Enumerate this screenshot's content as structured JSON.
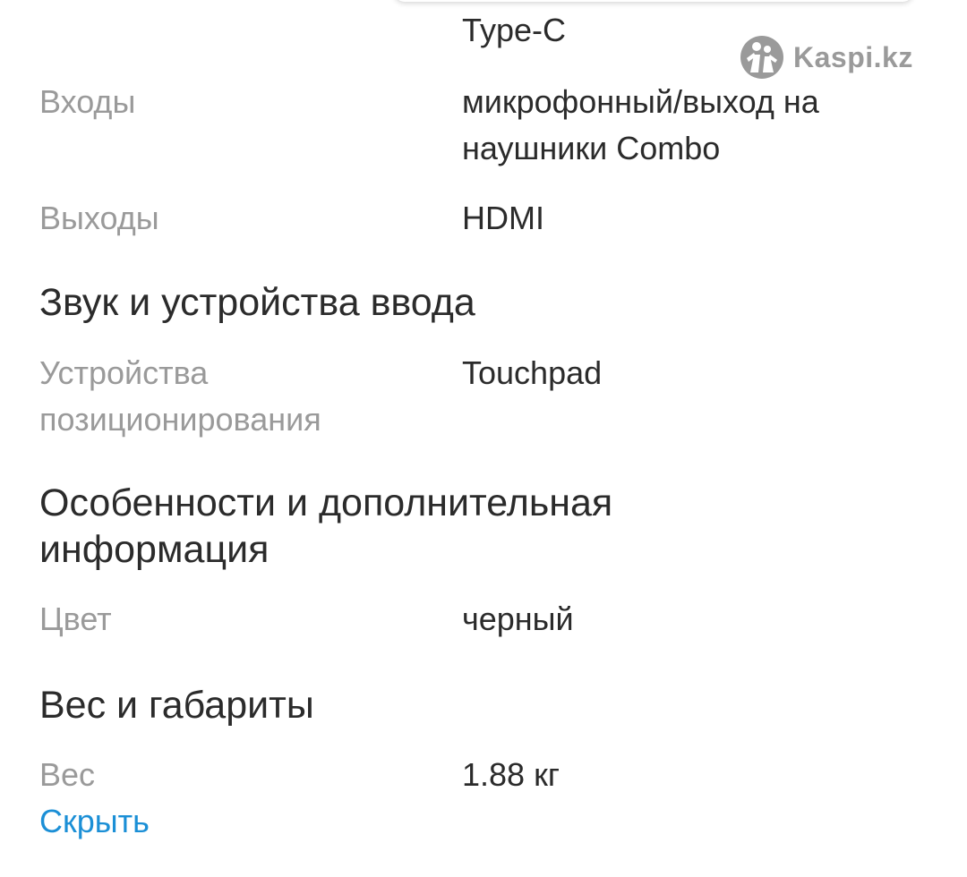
{
  "watermark": {
    "brand": "Kaspi.kz",
    "color": "#9a9a9a"
  },
  "top_partial": {
    "value_line2": "Type-C"
  },
  "specs": {
    "inputs": {
      "label": "Входы",
      "value_line1": "микрофонный/выход на",
      "value_line2": "наушники Combo"
    },
    "outputs": {
      "label": "Выходы",
      "value": "HDMI"
    },
    "sound_section_title": "Звук и устройства ввода",
    "pointing_devices": {
      "label_line1": "Устройства",
      "label_line2": "позиционирования",
      "value": "Touchpad"
    },
    "features_section_title_line1": "Особенности и дополнительная",
    "features_section_title_line2": "информация",
    "color": {
      "label": "Цвет",
      "value": "черный"
    },
    "weight_section_title": "Вес и габариты",
    "weight": {
      "label": "Вес",
      "value": "1.88 кг"
    }
  },
  "actions": {
    "hide_label": "Скрыть"
  },
  "colors": {
    "label": "#9a9a9a",
    "value": "#2b2b2b",
    "link": "#1b8fd6"
  }
}
